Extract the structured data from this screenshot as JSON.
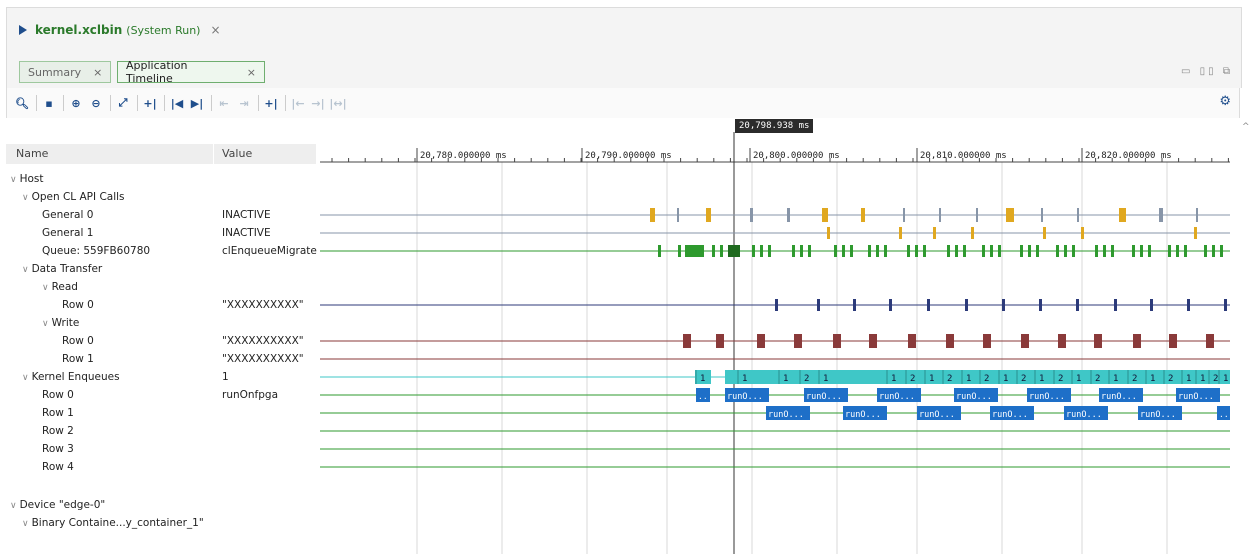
{
  "file_tab": {
    "name": "kernel.xclbin",
    "subtitle": "(System Run)",
    "close": "×"
  },
  "tabs": [
    {
      "label": "Summary",
      "close": "×",
      "active": false
    },
    {
      "label": "Application Timeline",
      "close": "×",
      "active": true
    }
  ],
  "columns": {
    "name": "Name",
    "value": "Value"
  },
  "cursor_time": "20,798.938 ms",
  "ruler_ticks": [
    "20,780.000000 ms",
    "20,790.000000 ms",
    "20,800.000000 ms",
    "20,810.000000 ms",
    "20,820.000000 ms"
  ],
  "tree": [
    {
      "label": "Host",
      "value": "",
      "expanded": true
    },
    {
      "label": "Open CL API Calls",
      "value": "",
      "expanded": true
    },
    {
      "label": "General 0",
      "value": "INACTIVE"
    },
    {
      "label": "General 1",
      "value": "INACTIVE"
    },
    {
      "label": "Queue: 559FB60780",
      "value": "clEnqueueMigrate"
    },
    {
      "label": "Data Transfer",
      "value": "",
      "expanded": true
    },
    {
      "label": "Read",
      "value": "",
      "expanded": true
    },
    {
      "label": "Row 0",
      "value": "\"XXXXXXXXXX\""
    },
    {
      "label": "Write",
      "value": "",
      "expanded": true
    },
    {
      "label": "Row 0",
      "value": "\"XXXXXXXXXX\""
    },
    {
      "label": "Row 1",
      "value": "\"XXXXXXXXXX\""
    },
    {
      "label": "Kernel Enqueues",
      "value": "1",
      "expanded": true
    },
    {
      "label": "Row 0",
      "value": "runOnfpga"
    },
    {
      "label": "Row 1",
      "value": ""
    },
    {
      "label": "Row 2",
      "value": ""
    },
    {
      "label": "Row 3",
      "value": ""
    },
    {
      "label": "Row 4",
      "value": ""
    },
    {
      "label": "Device \"edge-0\"",
      "value": "",
      "expanded": true
    },
    {
      "label": "Binary Containe...y_container_1\"",
      "value": "",
      "expanded": true
    }
  ],
  "kernel_label": "runO...",
  "kernel_short": "..",
  "colors": {
    "accent": "#2b7a2b",
    "gold": "#e0a820",
    "grey": "#8795a8",
    "green": "#2e9a2e",
    "navy": "#2c3a7a",
    "maroon": "#8a3a3a",
    "teal": "#3fc7c7",
    "blue": "#1e6fc8"
  }
}
